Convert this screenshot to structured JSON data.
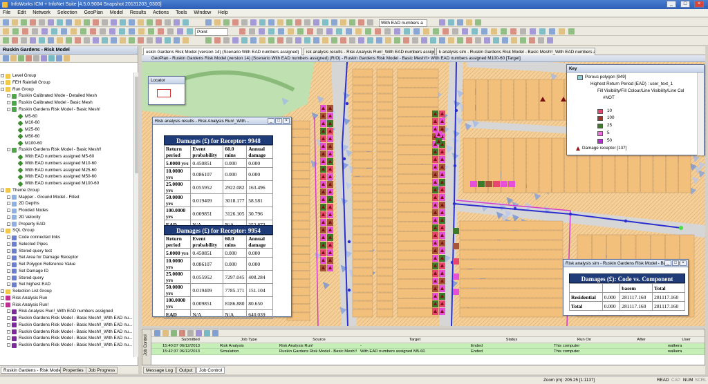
{
  "window": {
    "title": "InfoWorks ICM + InfoNet Suite [4.5.0.9004 Snapshot 20131203_0300]",
    "controls": [
      "_",
      "□",
      "×"
    ]
  },
  "menu": [
    "File",
    "Edit",
    "Network",
    "Selection",
    "GeoPlan",
    "Model",
    "Results",
    "Actions",
    "Tools",
    "Window",
    "Help"
  ],
  "toolbar": {
    "scenario_select": "With EAD numbers a",
    "selection_mode": "Point"
  },
  "left_panel": {
    "title": "Ruskin Gardens - Risk Model",
    "tree": [
      {
        "label": "Level Group",
        "level": 0,
        "icon": "group-folder-icon"
      },
      {
        "label": "FEH Rainfall Group",
        "level": 0,
        "icon": "group-folder-icon"
      },
      {
        "label": "Run Group",
        "level": 0,
        "icon": "group-folder-icon"
      },
      {
        "label": "Ruskin Calibrated Mode - Detailed Mesh",
        "level": 1,
        "icon": "run-icon"
      },
      {
        "label": "Ruskin Calibrated Model - Basic Mesh",
        "level": 1,
        "icon": "run-icon"
      },
      {
        "label": "Ruskin Gardens Risk Model - Basic Mesh!",
        "level": 1,
        "icon": "run-icon"
      },
      {
        "label": "M5-60",
        "level": 2,
        "icon": "sim-icon"
      },
      {
        "label": "M10-60",
        "level": 2,
        "icon": "sim-icon"
      },
      {
        "label": "M25-60",
        "level": 2,
        "icon": "sim-icon"
      },
      {
        "label": "M50-60",
        "level": 2,
        "icon": "sim-icon"
      },
      {
        "label": "M100-60",
        "level": 2,
        "icon": "sim-icon"
      },
      {
        "label": "Ruskin Gardens Risk Model - Basic Mesh!!",
        "level": 1,
        "icon": "run-icon"
      },
      {
        "label": "With EAD numbers assigned M5-60",
        "level": 2,
        "icon": "sim-icon"
      },
      {
        "label": "With EAD numbers assigned M10-60",
        "level": 2,
        "icon": "sim-icon"
      },
      {
        "label": "With EAD numbers assigned M25-60",
        "level": 2,
        "icon": "sim-icon"
      },
      {
        "label": "With EAD numbers assigned M50-60",
        "level": 2,
        "icon": "sim-icon"
      },
      {
        "label": "With EAD numbers assigned M100-60",
        "level": 2,
        "icon": "sim-icon"
      },
      {
        "label": "Theme Group",
        "level": 0,
        "icon": "group-folder-icon"
      },
      {
        "label": "Mapper - Ground Model - Filled",
        "level": 1,
        "icon": "theme-icon"
      },
      {
        "label": "2D Depths",
        "level": 1,
        "icon": "theme-icon"
      },
      {
        "label": "Flooded Nodes",
        "level": 1,
        "icon": "theme-icon"
      },
      {
        "label": "2D Velocity",
        "level": 1,
        "icon": "theme-icon"
      },
      {
        "label": "Property EAD",
        "level": 1,
        "icon": "theme-icon"
      },
      {
        "label": "SQL Group",
        "level": 0,
        "icon": "group-folder-icon"
      },
      {
        "label": "Code connected links",
        "level": 1,
        "icon": "sql-icon"
      },
      {
        "label": "Selected Pipes",
        "level": 1,
        "icon": "sql-icon"
      },
      {
        "label": "Stored query test",
        "level": 1,
        "icon": "sql-icon"
      },
      {
        "label": "Set Area for Damage Receptor",
        "level": 1,
        "icon": "sql-icon"
      },
      {
        "label": "Set Polygon Reference Value",
        "level": 1,
        "icon": "sql-icon"
      },
      {
        "label": "Set Damage ID",
        "level": 1,
        "icon": "sql-icon"
      },
      {
        "label": "Stored query",
        "level": 1,
        "icon": "sql-icon"
      },
      {
        "label": "Set highest EAD",
        "level": 1,
        "icon": "sql-icon"
      },
      {
        "label": "Selection List Group",
        "level": 0,
        "icon": "group-folder-icon"
      },
      {
        "label": "Risk Analysis Run",
        "level": 0,
        "icon": "risk-run-icon"
      },
      {
        "label": "Risk Analysis Run!",
        "level": 0,
        "icon": "risk-run-icon"
      },
      {
        "label": "Risk Analysis Run!_With EAD numbers assigned",
        "level": 1,
        "icon": "risk-result-icon"
      },
      {
        "label": "Ruskin Gardens Risk Model - Basic Mesh!!_With EAD nu...",
        "level": 1,
        "icon": "risk-result-icon"
      },
      {
        "label": "Ruskin Gardens Risk Model - Basic Mesh!!_With EAD nu...",
        "level": 1,
        "icon": "risk-result-icon"
      },
      {
        "label": "Ruskin Gardens Risk Model - Basic Mesh!!_With EAD nu...",
        "level": 1,
        "icon": "risk-result-icon"
      },
      {
        "label": "Ruskin Gardens Risk Model - Basic Mesh!!_With EAD nu...",
        "level": 1,
        "icon": "risk-result-icon"
      },
      {
        "label": "Ruskin Gardens Risk Model - Basic Mesh!!_With EAD nu...",
        "level": 1,
        "icon": "risk-result-icon"
      }
    ],
    "tabs": [
      "Ruskin Gardens - Risk Model",
      "Properties",
      "Job Progress"
    ]
  },
  "doc_tabs": [
    "uskin Gardens Risk Model (version 14) (Scenario With EAD numbers assigned)",
    "isk analysis results - Risk Analysis Run!_With EAD numbers assigned",
    "k analysis sim - Ruskin Gardens Risk Model - Basic Mesh!!_With EAD numbers assigned M100-"
  ],
  "geoplan": {
    "title": "GeoPlan - Ruskin Gardens Risk Model (version 14) (Scenario With EAD numbers assigned) (R/O) - Ruskin Gardens Risk Model - Basic Mesh!!> With EAD numbers assigned M100-60 [Target]",
    "locator_label": "Locator"
  },
  "results_window": {
    "title": "Risk analysis results - Risk Analysis Run!_With...",
    "tables": [
      {
        "heading": "Damages (£) for Receptor: 9948",
        "columns": [
          "Return period",
          "Event probability",
          "60.0 mins",
          "Annual damage"
        ],
        "rows": [
          [
            "5.0000 yrs",
            "0.450851",
            "0.000",
            "0.000"
          ],
          [
            "10.0000 yrs",
            "0.086107",
            "0.000",
            "0.000"
          ],
          [
            "25.0000 yrs",
            "0.055952",
            "2922.082",
            "163.496"
          ],
          [
            "50.0000 yrs",
            "0.019409",
            "3018.177",
            "58.581"
          ],
          [
            "100.0000 yrs",
            "0.009851",
            "3126.105",
            "30.796"
          ],
          [
            "EAD",
            "N/A",
            "N/A",
            "252.873"
          ]
        ]
      },
      {
        "heading": "Damages (£) for Receptor: 9954",
        "columns": [
          "Return period",
          "Event probability",
          "60.0 mins",
          "Annual damage"
        ],
        "rows": [
          [
            "5.0000 yrs",
            "0.450851",
            "0.000",
            "0.000"
          ],
          [
            "10.0000 yrs",
            "0.086107",
            "0.000",
            "0.000"
          ],
          [
            "25.0000 yrs",
            "0.055952",
            "7297.045",
            "408.284"
          ],
          [
            "50.0000 yrs",
            "0.019409",
            "7785.171",
            "151.104"
          ],
          [
            "100.0000 yrs",
            "0.009851",
            "8186.880",
            "80.650"
          ],
          [
            "EAD",
            "N/A",
            "N/A",
            "640.039"
          ]
        ]
      }
    ]
  },
  "key_window": {
    "title": "Key",
    "items": [
      {
        "label": "Porous polygon [949]"
      },
      {
        "label": "Highest Return Period (EAD) : user_text_1"
      },
      {
        "label": "Fill Visibility/Fill Colour/Line Visibility/Line Col"
      },
      {
        "label": "#NOT"
      },
      {
        "label": "10",
        "color": "#e8456f"
      },
      {
        "label": "100",
        "color": "#a0342c"
      },
      {
        "label": "25",
        "color": "#3f7a2a"
      },
      {
        "label": "5",
        "color": "#ee6fe0"
      },
      {
        "label": "50",
        "color": "#b030c8"
      },
      {
        "label": "Damage receptor [137]"
      }
    ]
  },
  "sim_window": {
    "title": "Risk analysis sim - Ruskin Gardens Risk Model - Basic Mes...",
    "heading": "Damages (£): Code vs. Component",
    "columns": [
      "",
      "",
      "basem",
      "Total"
    ],
    "rows": [
      [
        "Residential",
        "0.000",
        "281117.160",
        "281117.160"
      ],
      [
        "Total",
        "0.000",
        "281117.160",
        "281117.160"
      ]
    ]
  },
  "job_control": {
    "side_label": "Job Control",
    "columns": [
      "",
      "Submitted",
      "Job Type",
      "Source",
      "Target",
      "Status",
      "Run On",
      "After",
      "User"
    ],
    "rows": [
      [
        "",
        "15:40:07 06/12/2013",
        "Risk Analysis",
        "Risk Analysis Run!",
        "-",
        "Ended",
        "This computer",
        "",
        "walkera"
      ],
      [
        "",
        "15:42:37 06/12/2013",
        "Simulation",
        "Ruskin Gardens Risk Model - Basic Mesh!!",
        "With EAD numbers assigned M5-60",
        "Ended",
        "This computer",
        "",
        "walkera"
      ]
    ],
    "tabs": [
      "Message Log",
      "Output",
      "Job Control"
    ]
  },
  "status_bar": {
    "zoom": "Zoom (m): 205.25 [1:1137]",
    "indicators": [
      "READ",
      "CAP",
      "NUM",
      "SCRL"
    ]
  },
  "colors": {
    "magenta": "#e84fd8",
    "green": "#3e7a2c",
    "brown": "#a8543a",
    "road": "#cfcfcf",
    "building": "#f3c07c",
    "pipe": "#2b2fd0"
  }
}
